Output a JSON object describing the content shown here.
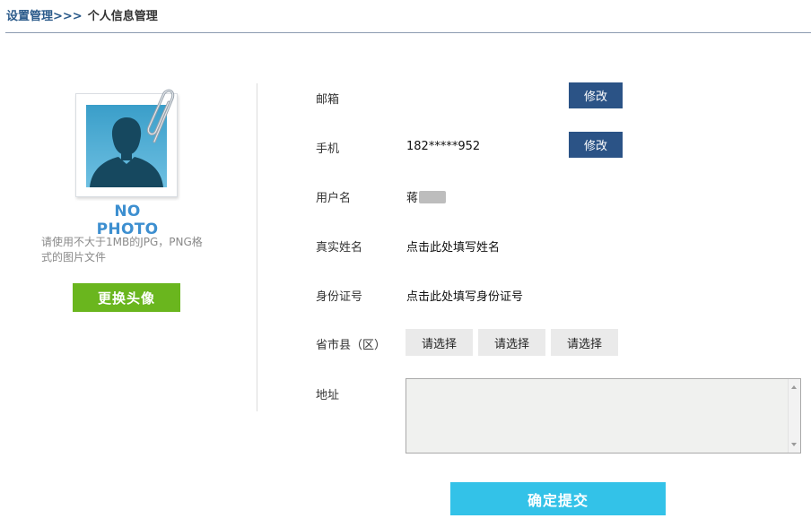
{
  "breadcrumb": {
    "parent": "设置管理",
    "separator": ">>>",
    "current": "个人信息管理"
  },
  "avatar": {
    "placeholder_text": "NO PHOTO",
    "hint": "请使用不大于1MB的JPG，PNG格式的图片文件",
    "change_button": "更换头像"
  },
  "form": {
    "email": {
      "label": "邮箱",
      "value": "",
      "button": "修改"
    },
    "phone": {
      "label": "手机",
      "value": "182*****952",
      "button": "修改"
    },
    "username": {
      "label": "用户名",
      "value": "蒋"
    },
    "real_name": {
      "label": "真实姓名",
      "value": "点击此处填写姓名"
    },
    "id_number": {
      "label": "身份证号",
      "value": "点击此处填写身份证号"
    },
    "region": {
      "label": "省市县（区）",
      "province": "请选择",
      "city": "请选择",
      "county": "请选择"
    },
    "address": {
      "label": "地址",
      "value": ""
    }
  },
  "submit_button": "确定提交",
  "colors": {
    "modify_button": "#2b5386",
    "change_avatar_button": "#6ab61e",
    "submit_button": "#33c2e8",
    "no_photo_text": "#3d8fd0"
  }
}
